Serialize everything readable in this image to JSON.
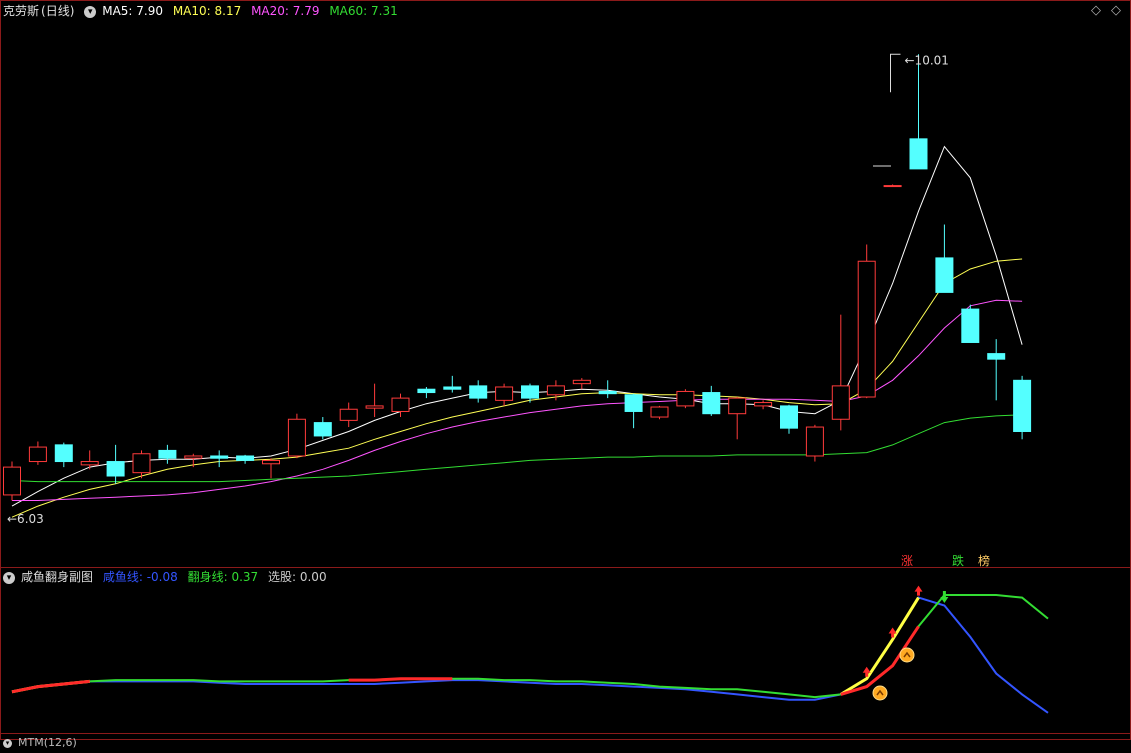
{
  "main_header": {
    "stock_name": "克劳斯",
    "period": "(日线)",
    "ma5": "MA5: 7.90",
    "ma10": "MA10: 8.17",
    "ma20": "MA20: 7.79",
    "ma60": "MA60: 7.31",
    "collapse_icon": "chevron-down-icon",
    "colors": {
      "stock_name": "#e0e0e0",
      "ma5": "#ffffff",
      "ma10": "#ffff55",
      "ma20": "#ff55ff",
      "ma60": "#33dd33"
    }
  },
  "sub_header": {
    "indicator_name": "咸鱼翻身副图",
    "xianyu": "咸鱼线: -0.08",
    "fanshen": "翻身线: 0.37",
    "xuangu": "选股: 0.00",
    "colors": {
      "xianyu": "#3355ff",
      "fanshen": "#33dd33",
      "xuangu": "#cccccc"
    }
  },
  "bottom_header": {
    "text": "MTM(12,6)"
  },
  "signals": [
    {
      "label": "涨",
      "color": "#ff3333"
    },
    {
      "label": "跌",
      "color": "#33dd33"
    },
    {
      "label": "榜",
      "color": "#ffcc66"
    }
  ],
  "chart_data": [
    {
      "type": "candlestick",
      "title": "克劳斯 (日线)",
      "ylim": [
        5.6,
        10.3
      ],
      "annotations": [
        {
          "label": "6.03",
          "x_index": 0,
          "price": 6.03
        },
        {
          "label": "10.01",
          "x_index": 35,
          "price": 10.01
        }
      ],
      "candles": [
        {
          "o": 6.05,
          "h": 6.35,
          "l": 6.0,
          "c": 6.3
        },
        {
          "o": 6.35,
          "h": 6.53,
          "l": 6.32,
          "c": 6.48
        },
        {
          "o": 6.5,
          "h": 6.52,
          "l": 6.3,
          "c": 6.35
        },
        {
          "o": 6.32,
          "h": 6.45,
          "l": 6.28,
          "c": 6.35
        },
        {
          "o": 6.35,
          "h": 6.5,
          "l": 6.15,
          "c": 6.22
        },
        {
          "o": 6.25,
          "h": 6.45,
          "l": 6.2,
          "c": 6.42
        },
        {
          "o": 6.45,
          "h": 6.5,
          "l": 6.33,
          "c": 6.38
        },
        {
          "o": 6.38,
          "h": 6.42,
          "l": 6.3,
          "c": 6.4
        },
        {
          "o": 6.4,
          "h": 6.45,
          "l": 6.3,
          "c": 6.38
        },
        {
          "o": 6.4,
          "h": 6.41,
          "l": 6.33,
          "c": 6.36
        },
        {
          "o": 6.33,
          "h": 6.38,
          "l": 6.2,
          "c": 6.36
        },
        {
          "o": 6.4,
          "h": 6.78,
          "l": 6.38,
          "c": 6.73
        },
        {
          "o": 6.7,
          "h": 6.75,
          "l": 6.55,
          "c": 6.58
        },
        {
          "o": 6.72,
          "h": 6.88,
          "l": 6.66,
          "c": 6.82
        },
        {
          "o": 6.83,
          "h": 7.05,
          "l": 6.75,
          "c": 6.85
        },
        {
          "o": 6.8,
          "h": 6.96,
          "l": 6.75,
          "c": 6.92
        },
        {
          "o": 7.0,
          "h": 7.02,
          "l": 6.92,
          "c": 6.97
        },
        {
          "o": 7.02,
          "h": 7.12,
          "l": 6.97,
          "c": 7.0
        },
        {
          "o": 7.03,
          "h": 7.08,
          "l": 6.88,
          "c": 6.92
        },
        {
          "o": 6.9,
          "h": 7.05,
          "l": 6.85,
          "c": 7.02
        },
        {
          "o": 7.03,
          "h": 7.05,
          "l": 6.88,
          "c": 6.92
        },
        {
          "o": 6.95,
          "h": 7.08,
          "l": 6.9,
          "c": 7.03
        },
        {
          "o": 7.05,
          "h": 7.1,
          "l": 7.0,
          "c": 7.08
        },
        {
          "o": 6.98,
          "h": 7.08,
          "l": 6.92,
          "c": 6.96
        },
        {
          "o": 6.95,
          "h": 6.96,
          "l": 6.65,
          "c": 6.8
        },
        {
          "o": 6.75,
          "h": 6.85,
          "l": 6.73,
          "c": 6.84
        },
        {
          "o": 6.85,
          "h": 7.0,
          "l": 6.83,
          "c": 6.98
        },
        {
          "o": 6.97,
          "h": 7.03,
          "l": 6.76,
          "c": 6.78
        },
        {
          "o": 6.78,
          "h": 6.93,
          "l": 6.55,
          "c": 6.92
        },
        {
          "o": 6.85,
          "h": 6.9,
          "l": 6.82,
          "c": 6.88
        },
        {
          "o": 6.85,
          "h": 6.86,
          "l": 6.6,
          "c": 6.65
        },
        {
          "o": 6.4,
          "h": 6.68,
          "l": 6.35,
          "c": 6.66
        },
        {
          "o": 6.73,
          "h": 7.67,
          "l": 6.63,
          "c": 7.03
        },
        {
          "o": 6.93,
          "h": 8.3,
          "l": 6.92,
          "c": 8.15
        },
        {
          "o": 8.83,
          "h": 8.84,
          "l": 8.83,
          "c": 8.83
        },
        {
          "o": 9.25,
          "h": 10.01,
          "l": 8.98,
          "c": 8.98
        },
        {
          "o": 8.18,
          "h": 8.48,
          "l": 7.87,
          "c": 7.87
        },
        {
          "o": 7.72,
          "h": 7.76,
          "l": 7.42,
          "c": 7.42
        },
        {
          "o": 7.32,
          "h": 7.45,
          "l": 6.9,
          "c": 7.27
        },
        {
          "o": 7.08,
          "h": 7.12,
          "l": 6.55,
          "c": 6.62
        }
      ],
      "series": [
        {
          "name": "MA5",
          "color": "#ffffff",
          "values": [
            5.95,
            6.08,
            6.2,
            6.3,
            6.34,
            6.36,
            6.37,
            6.37,
            6.39,
            6.38,
            6.4,
            6.46,
            6.54,
            6.62,
            6.72,
            6.8,
            6.87,
            6.92,
            6.97,
            6.98,
            6.97,
            6.98,
            7.0,
            6.99,
            6.96,
            6.93,
            6.91,
            6.87,
            6.87,
            6.86,
            6.8,
            6.78,
            6.9,
            7.4,
            7.95,
            8.6,
            9.18,
            8.9,
            8.2,
            7.4
          ]
        },
        {
          "name": "MA10",
          "color": "#ffff55",
          "values": [
            5.85,
            5.95,
            6.03,
            6.1,
            6.15,
            6.22,
            6.28,
            6.32,
            6.35,
            6.36,
            6.37,
            6.39,
            6.43,
            6.47,
            6.55,
            6.62,
            6.69,
            6.75,
            6.8,
            6.85,
            6.9,
            6.93,
            6.96,
            6.97,
            6.96,
            6.95,
            6.95,
            6.94,
            6.93,
            6.91,
            6.88,
            6.86,
            6.87,
            7.0,
            7.25,
            7.6,
            7.95,
            8.08,
            8.15,
            8.17
          ]
        },
        {
          "name": "MA20",
          "color": "#ff55ff",
          "values": [
            6.0,
            6.0,
            6.01,
            6.02,
            6.03,
            6.04,
            6.05,
            6.07,
            6.1,
            6.13,
            6.17,
            6.22,
            6.28,
            6.36,
            6.45,
            6.53,
            6.6,
            6.66,
            6.71,
            6.75,
            6.79,
            6.82,
            6.85,
            6.87,
            6.88,
            6.89,
            6.9,
            6.91,
            6.91,
            6.91,
            6.91,
            6.9,
            6.89,
            6.94,
            7.08,
            7.3,
            7.55,
            7.75,
            7.8,
            7.79
          ]
        },
        {
          "name": "MA60",
          "color": "#33dd33",
          "values": [
            6.18,
            6.17,
            6.17,
            6.17,
            6.17,
            6.17,
            6.17,
            6.17,
            6.17,
            6.18,
            6.19,
            6.2,
            6.21,
            6.22,
            6.24,
            6.26,
            6.28,
            6.3,
            6.32,
            6.34,
            6.36,
            6.37,
            6.38,
            6.39,
            6.39,
            6.4,
            6.4,
            6.4,
            6.41,
            6.41,
            6.41,
            6.41,
            6.42,
            6.43,
            6.5,
            6.6,
            6.7,
            6.74,
            6.76,
            6.77
          ]
        }
      ]
    },
    {
      "type": "line",
      "title": "咸鱼翻身副图",
      "ylim": [
        -0.1,
        0.37
      ],
      "series": [
        {
          "name": "咸鱼线",
          "color": "#3355ff",
          "values": [
            0.0,
            0.02,
            0.03,
            0.04,
            0.04,
            0.04,
            0.04,
            0.04,
            0.035,
            0.03,
            0.03,
            0.03,
            0.03,
            0.03,
            0.03,
            0.035,
            0.04,
            0.045,
            0.045,
            0.04,
            0.035,
            0.03,
            0.03,
            0.025,
            0.02,
            0.015,
            0.01,
            0.0,
            -0.01,
            -0.02,
            -0.03,
            -0.03,
            -0.01,
            0.05,
            0.2,
            0.36,
            0.33,
            0.21,
            0.07,
            -0.01,
            -0.08
          ]
        },
        {
          "name": "翻身线",
          "color": "#33dd33",
          "values": [
            0.0,
            0.02,
            0.03,
            0.04,
            0.045,
            0.045,
            0.045,
            0.045,
            0.04,
            0.04,
            0.04,
            0.04,
            0.04,
            0.045,
            0.045,
            0.05,
            0.05,
            0.05,
            0.05,
            0.045,
            0.045,
            0.04,
            0.04,
            0.035,
            0.03,
            0.02,
            0.015,
            0.01,
            0.01,
            0.0,
            -0.01,
            -0.02,
            -0.01,
            0.02,
            0.1,
            0.25,
            0.37,
            0.37,
            0.37,
            0.36,
            0.28
          ]
        }
      ]
    }
  ]
}
